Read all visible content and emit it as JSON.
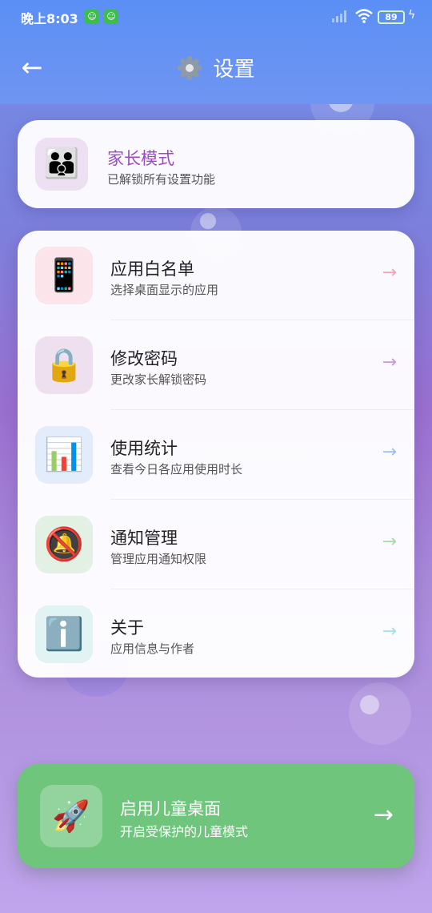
{
  "status_bar": {
    "time": "晚上8:03",
    "battery": "89",
    "app_icons": [
      "app-notification-icon",
      "app-notification-icon"
    ]
  },
  "header": {
    "title": "设置",
    "icon": "gear-icon"
  },
  "parent_mode": {
    "title": "家长模式",
    "subtitle": "已解锁所有设置功能",
    "icon": "family-icon",
    "icon_glyph": "👪",
    "title_color": "#9b4dbf"
  },
  "menu": {
    "items": [
      {
        "title": "应用白名单",
        "subtitle": "选择桌面显示的应用",
        "icon": "phone-icon",
        "glyph": "📱",
        "icon_bg": "#fbe4ea",
        "arrow_color": "#f0a6b4"
      },
      {
        "title": "修改密码",
        "subtitle": "更改家长解锁密码",
        "icon": "lock-icon",
        "glyph": "🔒",
        "icon_bg": "#efe0f0",
        "arrow_color": "#c89ad6"
      },
      {
        "title": "使用统计",
        "subtitle": "查看今日各应用使用时长",
        "icon": "bar-chart-icon",
        "glyph": "📊",
        "icon_bg": "#e2ecfb",
        "arrow_color": "#9dbff0"
      },
      {
        "title": "通知管理",
        "subtitle": "管理应用通知权限",
        "icon": "bell-off-icon",
        "glyph": "🔕",
        "icon_bg": "#e3f1e5",
        "arrow_color": "#a6dab0"
      },
      {
        "title": "关于",
        "subtitle": "应用信息与作者",
        "icon": "info-icon",
        "glyph": "ℹ️",
        "icon_bg": "#e1f3f3",
        "arrow_color": "#a8e0e0"
      }
    ],
    "arrow": "→"
  },
  "launch": {
    "title": "启用儿童桌面",
    "subtitle": "开启受保护的儿童模式",
    "icon": "rocket-icon",
    "glyph": "🚀",
    "arrow": "→",
    "background": "#6fc57c"
  }
}
